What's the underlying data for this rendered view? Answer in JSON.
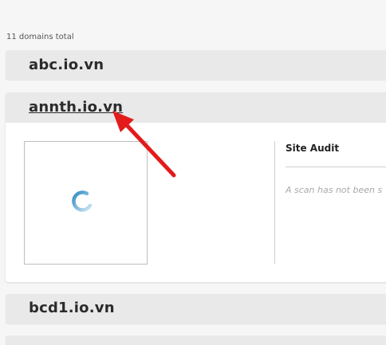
{
  "summary": {
    "count_label": "11 domains total"
  },
  "domains": [
    {
      "name": "abc.io.vn",
      "expanded": false
    },
    {
      "name": "annth.io.vn",
      "expanded": true
    },
    {
      "name": "bcd1.io.vn",
      "expanded": false
    },
    {
      "name": "",
      "expanded": false
    }
  ],
  "expanded_panel": {
    "thumbnail_state_icon": "loading-spinner-icon",
    "site_audit_title": "Site Audit",
    "scan_message": "A scan has not been s"
  },
  "annotation": {
    "arrow_color": "#e31b1b",
    "arrow_icon": "red-arrow-icon"
  },
  "colors": {
    "spinner": "#4a9fd0",
    "row_bg": "#e9e9e9"
  }
}
